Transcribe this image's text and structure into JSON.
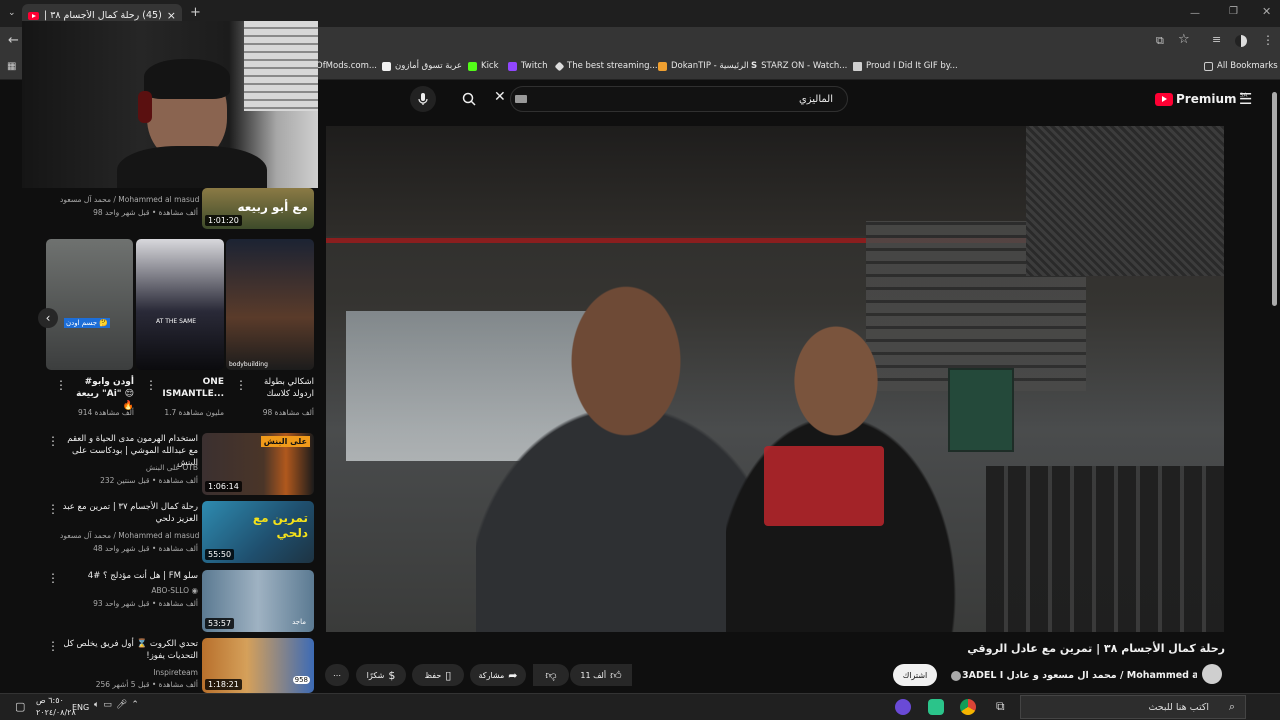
{
  "browser": {
    "tab_title": "(45) رحلة كمال الأجسام ٣٨ | تمرين",
    "tab_close": "×",
    "new_tab": "+",
    "bookmarks": [
      {
        "label": "OfMods.com...",
        "color": "#888888"
      },
      {
        "label": "عربة تسوق أمازون",
        "color": "#f2f2f2"
      },
      {
        "label": "Kick",
        "color": "#53fc18"
      },
      {
        "label": "Twitch",
        "color": "#9146ff"
      },
      {
        "label": "The best streaming...",
        "color": "#dddddd"
      },
      {
        "label": "DokanTIP - الرئيسية",
        "color": "#f0a030"
      },
      {
        "label": "STARZ ON - Watch...",
        "color": "#ffffff"
      },
      {
        "label": "Proud I Did It GIF by...",
        "color": "#d0d0d0"
      }
    ],
    "all_bookmarks": "All Bookmarks"
  },
  "youtube": {
    "logo_text": "Premium",
    "region": "SA",
    "search_value": "الماليزي",
    "video": {
      "title": "رحلة كمال الأجسام ٣٨ | تمرين مع عادل الروقي",
      "channel": "3ADEL I محمد آل مسعود و عادل / Mohammed al masud",
      "subscribe": "اشتراك",
      "likes": "11 ألف",
      "share": "مشاركة",
      "save": "حفظ",
      "thanks": "شكرًا"
    },
    "sidebar": {
      "top_item": {
        "channel": "محمد آل مسعود / Mohammed al masud",
        "meta": "98 ألف مشاهدة • قبل شهر واحد",
        "duration": "1:01:20",
        "thumb_text": "مع أبو ربيعه"
      },
      "shorts": [
        {
          "title": "#أودن وابو ربيعة \"Ai\" 😌 🔥",
          "views": "914 ألف مشاهدة",
          "badge": "جسم اودن 🤔"
        },
        {
          "title": "ONE ISMANTLE...",
          "views": "1.7 مليون مشاهدة",
          "badge": "AT THE SAME"
        },
        {
          "title": "اشكالي بطولة اردولد كلاسك",
          "views": "98 ألف مشاهدة",
          "badge": "bodybuilding"
        }
      ],
      "videos": [
        {
          "title": "استخدام الهرمون مدى الحياة و العقم مع عبدالله الموشي | بودكاست على البنش",
          "channel": "على البنش OTB",
          "meta": "232 ألف مشاهدة • قبل سنتين",
          "duration": "1:06:14",
          "thumb_text": "على البنش"
        },
        {
          "title": "رحلة كمال الأجسام ٣٧ | تمرين مع عبد العزيز دلحي",
          "channel": "محمد آل مسعود / Mohammed al masud",
          "meta": "48 ألف مشاهدة • قبل شهر واحد",
          "duration": "55:50",
          "thumb_text": "تمرين مع دلحي"
        },
        {
          "title": "سلو FM | هل أنت مؤدلج ؟ #4",
          "channel": "ABO-SLLO",
          "meta": "93 ألف مشاهدة • قبل شهر واحد",
          "duration": "53:57",
          "thumb_text": "ماجد"
        },
        {
          "title": "تحدي الكروت ⌛ أول فريق يخلص كل التحديات يفوز!",
          "channel": "Inspireteam",
          "meta": "256 ألف مشاهدة • قبل 5 أشهر",
          "duration": "1:18:21",
          "thumb_text": "958"
        }
      ]
    }
  },
  "taskbar": {
    "search_placeholder": "اكتب هنا للبحث",
    "time": "٦:٥٠ ص",
    "date": "٢٠٢٤/٠٨/٢٨",
    "lang": "ENG"
  }
}
